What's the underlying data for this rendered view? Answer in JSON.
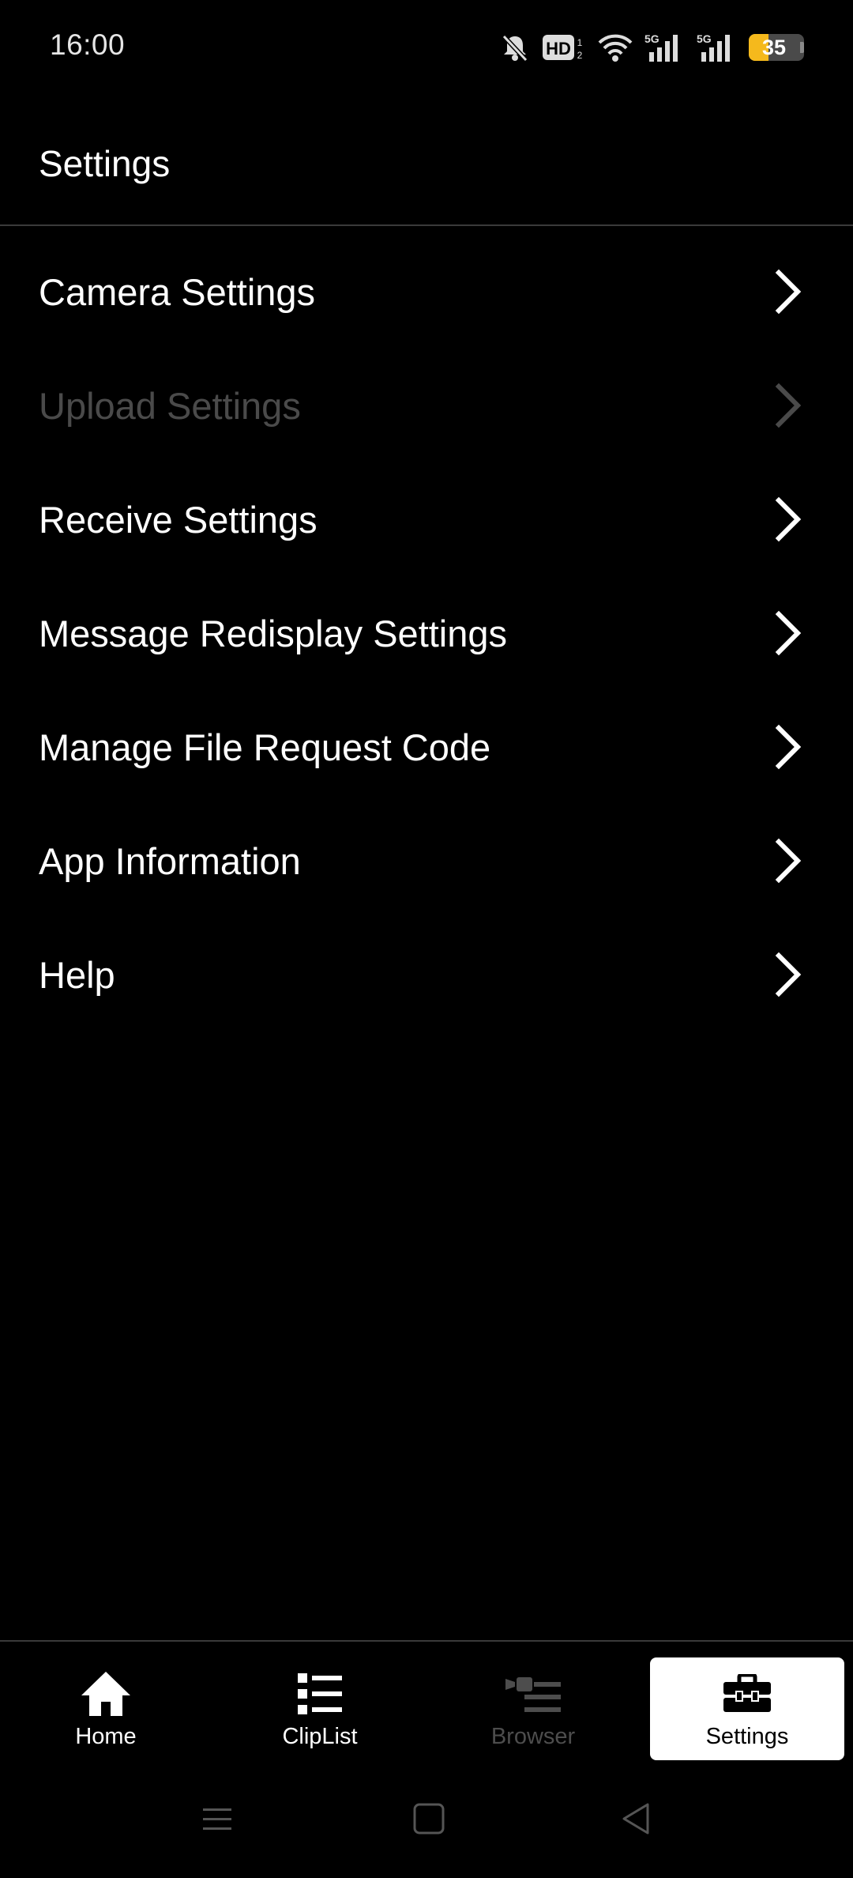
{
  "status_bar": {
    "time": "16:00",
    "icons": [
      "mute-bell-icon",
      "hd-voice-icon",
      "wifi-icon",
      "signal-5g-icon",
      "signal-5g-icon"
    ],
    "hd_label": "HD",
    "hd_sub": "1 2",
    "network_1": "5G",
    "network_2": "5G",
    "battery_level": "35",
    "battery_color": "#f5b91c"
  },
  "header": {
    "title": "Settings"
  },
  "menu": {
    "items": [
      {
        "label": "Camera Settings",
        "enabled": true
      },
      {
        "label": "Upload Settings",
        "enabled": false
      },
      {
        "label": "Receive Settings",
        "enabled": true
      },
      {
        "label": "Message Redisplay Settings",
        "enabled": true
      },
      {
        "label": "Manage File Request Code",
        "enabled": true
      },
      {
        "label": "App Information",
        "enabled": true
      },
      {
        "label": "Help",
        "enabled": true
      }
    ],
    "chevron_icon": "chevron-right-icon"
  },
  "bottom_nav": {
    "items": [
      {
        "label": "Home",
        "icon": "home-icon",
        "enabled": true,
        "active": false
      },
      {
        "label": "ClipList",
        "icon": "list-icon",
        "enabled": true,
        "active": false
      },
      {
        "label": "Browser",
        "icon": "browser-camera-icon",
        "enabled": false,
        "active": false
      },
      {
        "label": "Settings",
        "icon": "toolbox-icon",
        "enabled": true,
        "active": true
      }
    ]
  },
  "system_nav": {
    "icons": [
      "menu-icon",
      "home-square-icon",
      "back-triangle-icon"
    ]
  }
}
